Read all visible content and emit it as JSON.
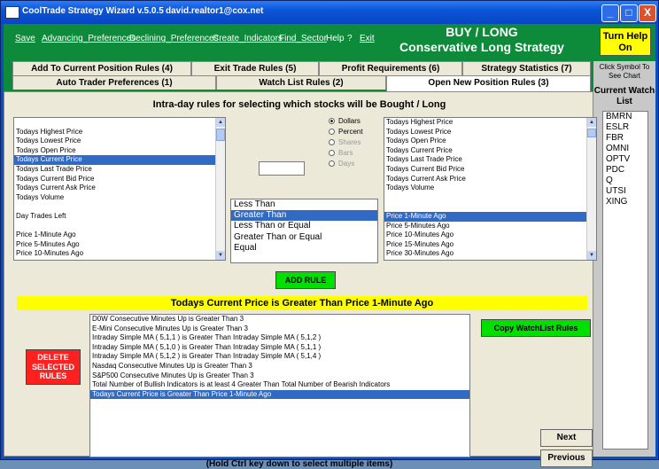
{
  "window": {
    "title": "CoolTrade Strategy Wizard  v.5.0.5",
    "user": "david.realtor1@cox.net",
    "minimize": "_",
    "maximize": "□",
    "close": "X"
  },
  "menu": {
    "items": [
      "Save",
      "Advancing_Preferences",
      "Declining_Preferences",
      "Create_Indicators",
      "Find_Sector",
      "Help",
      "?",
      "Exit"
    ]
  },
  "header": {
    "line1": "BUY / LONG",
    "line2": "Conservative Long Strategy",
    "turn_help": "Turn Help On"
  },
  "tabs": {
    "row1": [
      "Add To Current Position Rules (4)",
      "Exit Trade Rules (5)",
      "Profit Requirements (6)",
      "Strategy Statistics (7)"
    ],
    "row2": [
      "Auto Trader Preferences (1)",
      "Watch List Rules (2)",
      "Open New Position Rules (3)"
    ],
    "active": "Open New Position Rules (3)"
  },
  "sidebar": {
    "click_hint": "Click Symbol To See Chart",
    "watchlist_title": "Current Watch List",
    "symbols": [
      "BMRN",
      "ESLR",
      "FBR",
      "OMNI",
      "OPTV",
      "PDC",
      "Q",
      "UTSI",
      "XING"
    ]
  },
  "panel": {
    "heading": "Intra-day rules for selecting which stocks will be Bought / Long",
    "left_list": [
      "",
      "Todays Highest Price",
      "Todays Lowest Price",
      "Todays Open Price",
      "Todays Current Price",
      "Todays Last Trade Price",
      "Todays Current Bid Price",
      "Todays Current Ask Price",
      "Todays Volume",
      "",
      "Day Trades Left",
      "",
      "Price 1-Minute Ago",
      "Price 5-Minutes Ago",
      "Price 10-Minutes Ago"
    ],
    "left_selected": "Todays Current Price",
    "units": [
      "Dollars",
      "Percent",
      "Shares",
      "Bars",
      "Days"
    ],
    "unit_selected": "Dollars",
    "value_input": "",
    "operators": [
      "Less Than",
      "Greater Than",
      "Less Than or Equal",
      "Greater Than or Equal",
      "Equal"
    ],
    "operator_selected": "Greater Than",
    "add_rule": "ADD RULE",
    "right_list": [
      "Todays Highest Price",
      "Todays Lowest Price",
      "Todays Open Price",
      "Todays Current Price",
      "Todays Last Trade Price",
      "Todays Current Bid Price",
      "Todays Current Ask Price",
      "Todays Volume",
      "",
      "",
      "Price 1-Minute Ago",
      "Price 5-Minutes Ago",
      "Price 10-Minutes Ago",
      "Price 15-Minutes Ago",
      "Price 30-Minutes Ago"
    ],
    "right_selected": "Price 1-Minute Ago",
    "current_rule": "Todays Current Price is Greater Than Price 1-Minute Ago",
    "rules": [
      "D0W Consecutive Minutes Up is Greater Than 3",
      "E-Mini Consecutive Minutes Up is Greater Than 3",
      "Intraday Simple MA ( 5,1,1 )  is Greater Than Intraday Simple MA ( 5,1,2 )",
      "Intraday Simple MA ( 5,1,0 )  is Greater Than Intraday Simple MA ( 5,1,1 )",
      "Intraday Simple MA ( 5,1,2 )  is Greater Than Intraday Simple MA ( 5,1,4 )",
      "Nasdaq Consecutive Minutes Up is Greater Than 3",
      "S&P500 Consecutive Minutes Up is Greater Than 3",
      "Total Number of Bullish Indicators is at least 4 Greater Than Total Number of Bearish Indicators",
      "Todays Current Price is Greater Than Price 1-Minute Ago"
    ],
    "rule_selected": "Todays Current Price is Greater Than Price 1-Minute Ago",
    "delete_button": "DELETE SELECTED RULES",
    "copy_button": "Copy WatchList Rules",
    "next_button": "Next",
    "previous_button": "Previous",
    "hint": "(Hold Ctrl key down to select multiple items)"
  }
}
